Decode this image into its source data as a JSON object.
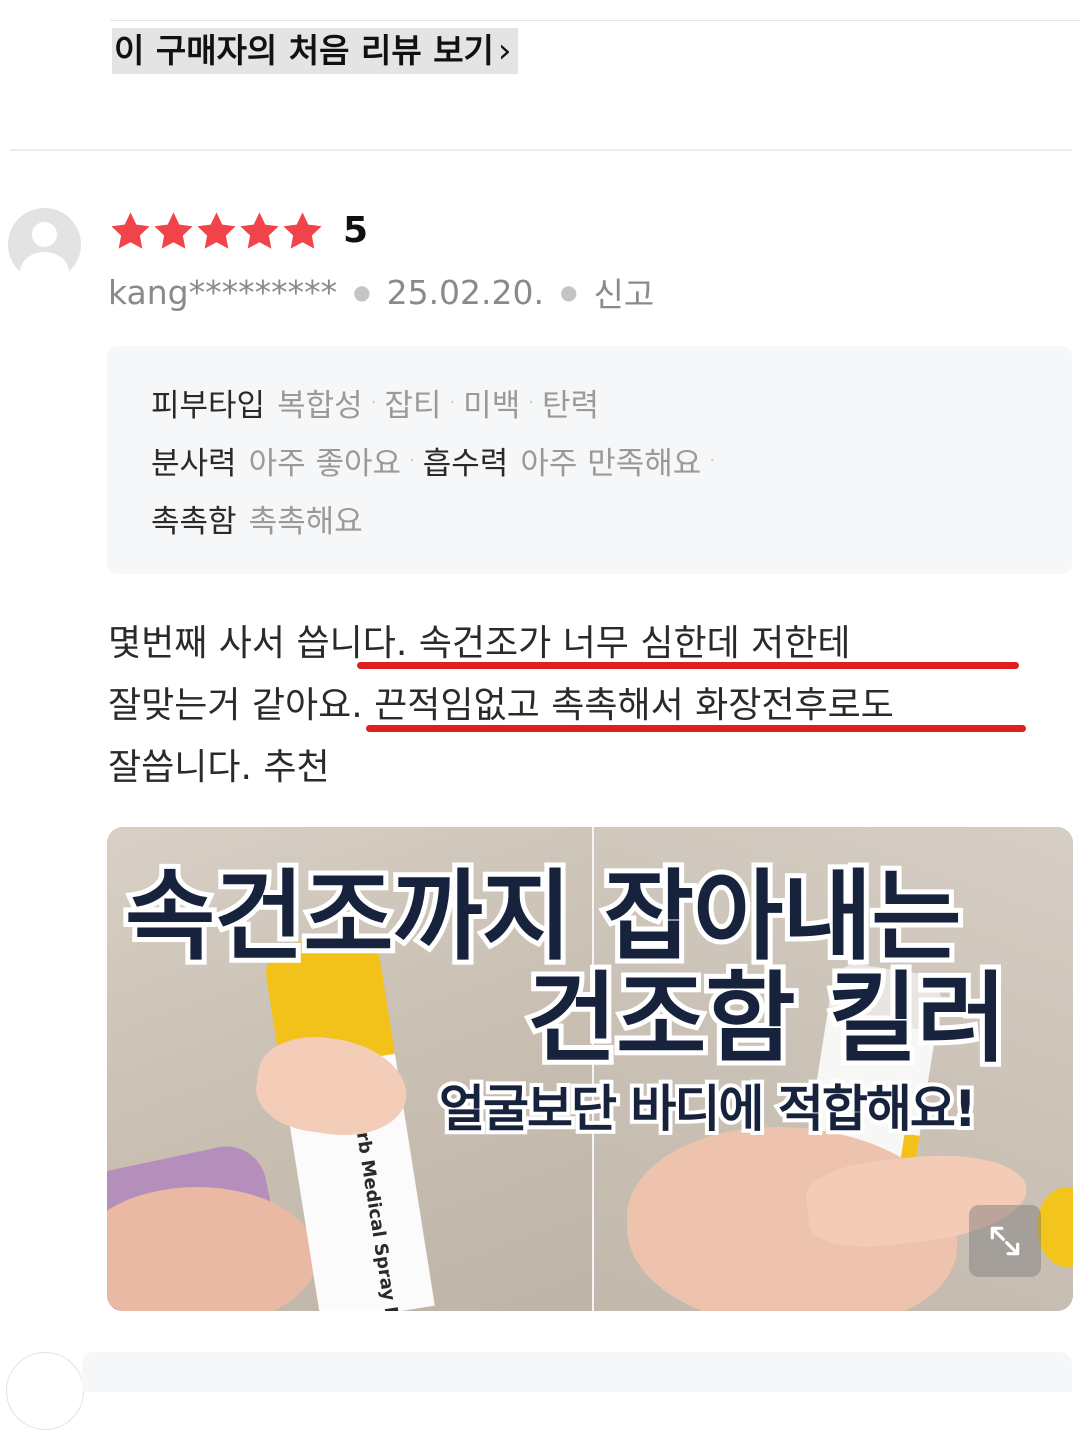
{
  "first_review_link": {
    "label": "이 구매자의 처음 리뷰 보기",
    "chevron": "›"
  },
  "review": {
    "rating": {
      "value": 5,
      "max": 5,
      "label": "5",
      "star_color": "#f0444a"
    },
    "author": "kang*********",
    "date": "25.02.20.",
    "report_label": "신고",
    "options": {
      "line1": {
        "key": "피부타입",
        "values": [
          "복합성",
          "잡티",
          "미백",
          "탄력"
        ]
      },
      "line2": {
        "key1": "분사력",
        "val1": "아주 좋아요",
        "key2": "흡수력",
        "val2": "아주 만족해요"
      },
      "line3": {
        "key": "촉촉함",
        "val": "촉촉해요"
      }
    },
    "body_lines": [
      "몇번째 사서 씁니다. 속건조가 너무 심한데 저한테",
      "잘맞는거 같아요. 끈적임없고 촉촉해서 화장전후로도",
      "잘씁니다. 추천"
    ],
    "highlight_color": "#e0201e"
  },
  "photo": {
    "headline_line1": "속건조까지 잡아내는",
    "headline_line2": "건조함 킬러",
    "headline_line3": "얼굴보단 바디에 적합해요!",
    "product_label": "orb Medical Spray Professional",
    "expand_icon": "expand-icon"
  }
}
